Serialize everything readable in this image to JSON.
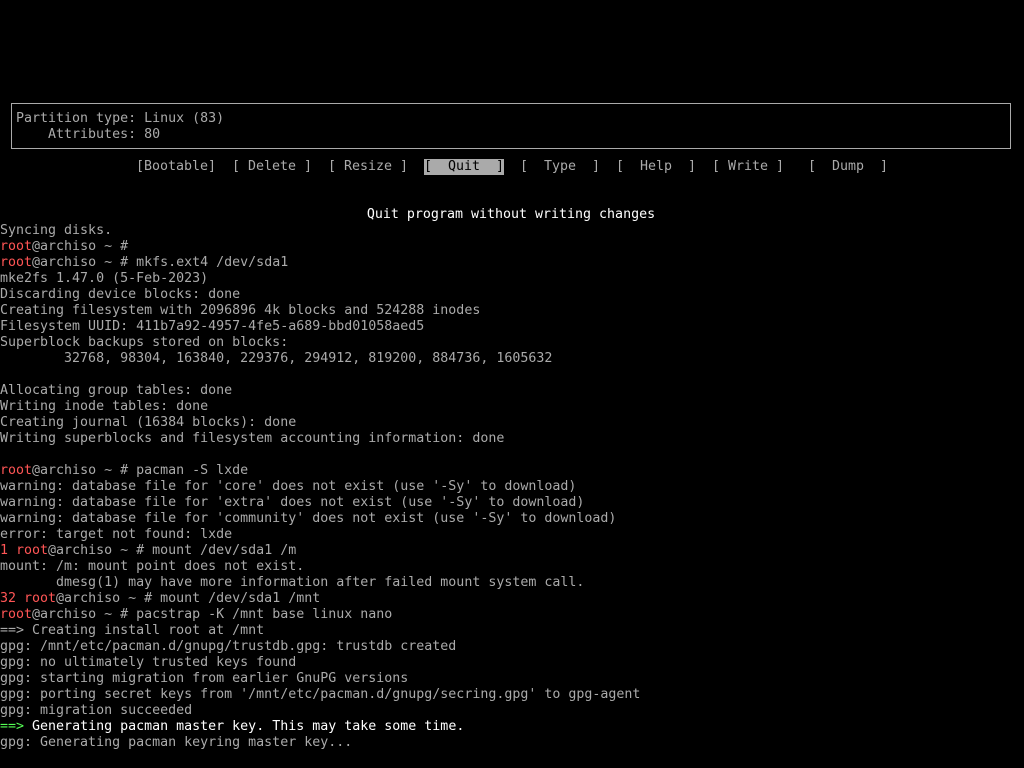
{
  "partition_info": {
    "type_line": "Partition type: Linux (83)",
    "attributes_line": "    Attributes: 80"
  },
  "menu": {
    "items": [
      {
        "label": "[Bootable]"
      },
      {
        "label": "[ Delete ]"
      },
      {
        "label": "[ Resize ]"
      },
      {
        "label": "[  Quit  ]",
        "selected": true
      },
      {
        "label": "[  Type  ]"
      },
      {
        "label": "[  Help  ]"
      },
      {
        "label": "[ Write ]"
      },
      {
        "label": "[  Dump  ]"
      }
    ],
    "hint": "Quit program without writing changes"
  },
  "terminal": {
    "lines": [
      {
        "parts": [
          {
            "t": "Syncing disks."
          }
        ]
      },
      {
        "parts": [
          {
            "t": "root",
            "c": "red"
          },
          {
            "t": "@archiso ~ #"
          }
        ]
      },
      {
        "parts": [
          {
            "t": "root",
            "c": "red"
          },
          {
            "t": "@archiso ~ # mkfs.ext4 /dev/sda1"
          }
        ]
      },
      {
        "parts": [
          {
            "t": "mke2fs 1.47.0 (5-Feb-2023)"
          }
        ]
      },
      {
        "parts": [
          {
            "t": "Discarding device blocks: done"
          }
        ]
      },
      {
        "parts": [
          {
            "t": "Creating filesystem with 2096896 4k blocks and 524288 inodes"
          }
        ]
      },
      {
        "parts": [
          {
            "t": "Filesystem UUID: 411b7a92-4957-4fe5-a689-bbd01058aed5"
          }
        ]
      },
      {
        "parts": [
          {
            "t": "Superblock backups stored on blocks:"
          }
        ]
      },
      {
        "parts": [
          {
            "t": "        32768, 98304, 163840, 229376, 294912, 819200, 884736, 1605632"
          }
        ]
      },
      {
        "parts": [
          {
            "t": ""
          }
        ]
      },
      {
        "parts": [
          {
            "t": "Allocating group tables: done"
          }
        ]
      },
      {
        "parts": [
          {
            "t": "Writing inode tables: done"
          }
        ]
      },
      {
        "parts": [
          {
            "t": "Creating journal (16384 blocks): done"
          }
        ]
      },
      {
        "parts": [
          {
            "t": "Writing superblocks and filesystem accounting information: done"
          }
        ]
      },
      {
        "parts": [
          {
            "t": ""
          }
        ]
      },
      {
        "parts": [
          {
            "t": "root",
            "c": "red"
          },
          {
            "t": "@archiso ~ # pacman -S lxde"
          }
        ]
      },
      {
        "parts": [
          {
            "t": "warning: database file for 'core' does not exist (use '-Sy' to download)"
          }
        ]
      },
      {
        "parts": [
          {
            "t": "warning: database file for 'extra' does not exist (use '-Sy' to download)"
          }
        ]
      },
      {
        "parts": [
          {
            "t": "warning: database file for 'community' does not exist (use '-Sy' to download)"
          }
        ]
      },
      {
        "parts": [
          {
            "t": "error: target not found: lxde"
          }
        ]
      },
      {
        "parts": [
          {
            "t": "1 root",
            "c": "red"
          },
          {
            "t": "@archiso ~ # mount /dev/sda1 /m"
          }
        ]
      },
      {
        "parts": [
          {
            "t": "mount: /m: mount point does not exist."
          }
        ]
      },
      {
        "parts": [
          {
            "t": "       dmesg(1) may have more information after failed mount system call."
          }
        ]
      },
      {
        "parts": [
          {
            "t": "32 root",
            "c": "red"
          },
          {
            "t": "@archiso ~ # mount /dev/sda1 /mnt"
          }
        ]
      },
      {
        "parts": [
          {
            "t": "root",
            "c": "red"
          },
          {
            "t": "@archiso ~ # pacstrap -K /mnt base linux nano"
          }
        ]
      },
      {
        "parts": [
          {
            "t": "==> Creating install root at /mnt"
          }
        ]
      },
      {
        "parts": [
          {
            "t": "gpg: /mnt/etc/pacman.d/gnupg/trustdb.gpg: trustdb created"
          }
        ]
      },
      {
        "parts": [
          {
            "t": "gpg: no ultimately trusted keys found"
          }
        ]
      },
      {
        "parts": [
          {
            "t": "gpg: starting migration from earlier GnuPG versions"
          }
        ]
      },
      {
        "parts": [
          {
            "t": "gpg: porting secret keys from '/mnt/etc/pacman.d/gnupg/secring.gpg' to gpg-agent"
          }
        ]
      },
      {
        "parts": [
          {
            "t": "gpg: migration succeeded"
          }
        ]
      },
      {
        "parts": [
          {
            "t": "==>",
            "c": "green"
          },
          {
            "t": " Generating pacman master key. This may take some time.",
            "c": "bold"
          }
        ]
      },
      {
        "parts": [
          {
            "t": "gpg: Generating pacman keyring master key..."
          }
        ]
      }
    ]
  },
  "colors": {
    "background": "#000000",
    "text": "#aaaaaa",
    "prompt_user": "#ff5555",
    "highlight": "#ffffff",
    "arrow": "#55ff55",
    "selected_bg": "#aaaaaa"
  }
}
